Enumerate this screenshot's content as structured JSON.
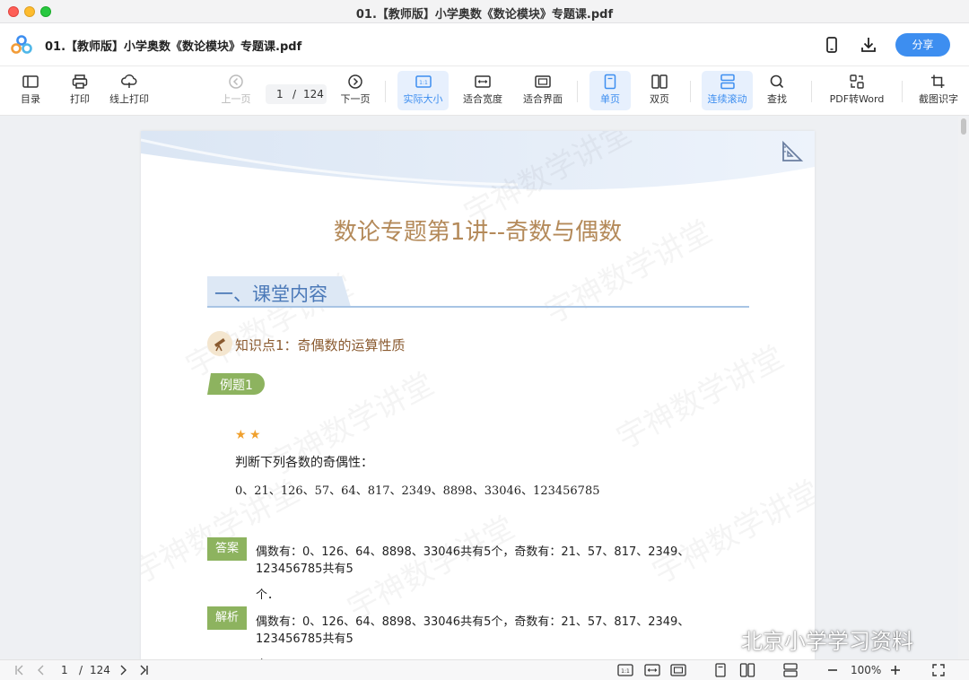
{
  "window": {
    "title": "01.【教师版】小学奥数《数论模块》专题课.pdf"
  },
  "header": {
    "doc_name": "01.【教师版】小学奥数《数论模块》专题课.pdf",
    "share_label": "分享"
  },
  "toolbar": {
    "toc": "目录",
    "print": "打印",
    "online_print": "线上打印",
    "prev": "上一页",
    "page_current": "1",
    "page_sep": "/",
    "page_total": "124",
    "next": "下一页",
    "actual_size": "实际大小",
    "fit_width": "适合宽度",
    "fit_page": "适合界面",
    "single": "单页",
    "double": "双页",
    "continuous": "连续滚动",
    "find": "查找",
    "pdf_to_word": "PDF转Word",
    "ocr": "截图识字",
    "active_items": [
      "实际大小",
      "单页",
      "连续滚动"
    ],
    "disabled_items": [
      "上一页"
    ]
  },
  "document": {
    "title": "数论专题第1讲--奇数与偶数",
    "section": "一、课堂内容",
    "knowledge_point": "知识点1：奇偶数的运算性质",
    "example_label": "例题1",
    "difficulty_stars": 2,
    "question": "判断下列各数的奇偶性：",
    "numbers": "0、21、126、57、64、817、2349、8898、33046、123456785",
    "answer_label": "答案",
    "answer_line1": "偶数有：0、126、64、8898、33046共有5个，奇数有：21、57、817、2349、123456785共有5",
    "answer_line2": "个．",
    "analysis_label": "解析",
    "analysis_line1": "偶数有：0、126、64、8898、33046共有5个，奇数有：21、57、817、2349、123456785共有5",
    "analysis_line2": "个．",
    "watermark": "宇神数学讲堂"
  },
  "overlay": {
    "wechat_text": "北京小学学习资料"
  },
  "statusbar": {
    "page_current": "1",
    "page_sep": "/",
    "page_total": "124",
    "zoom": "100%"
  },
  "colors": {
    "accent": "#3d8ef0",
    "title_brown": "#b48a5a",
    "section_blue": "#4b79b8",
    "tag_green": "#8db35f"
  }
}
